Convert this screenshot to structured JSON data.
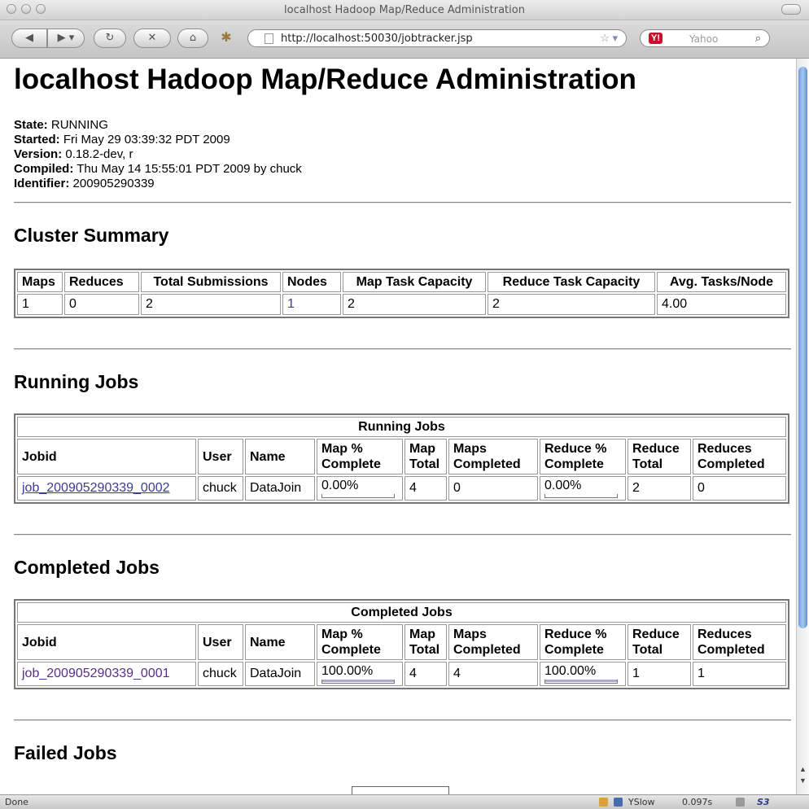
{
  "window": {
    "title": "localhost Hadoop Map/Reduce Administration"
  },
  "toolbar": {
    "url": "http://localhost:50030/jobtracker.jsp",
    "search_placeholder": "Yahoo",
    "yahoo_logo": "Y!"
  },
  "page": {
    "title": "localhost Hadoop Map/Reduce Administration",
    "info": {
      "state_label": "State:",
      "state": "RUNNING",
      "started_label": "Started:",
      "started": "Fri May 29 03:39:32 PDT 2009",
      "version_label": "Version:",
      "version": "0.18.2-dev, r",
      "compiled_label": "Compiled:",
      "compiled": "Thu May 14 15:55:01 PDT 2009 by chuck",
      "identifier_label": "Identifier:",
      "identifier": "200905290339"
    }
  },
  "cluster_summary": {
    "heading": "Cluster Summary",
    "headers": [
      "Maps",
      "Reduces",
      "Total Submissions",
      "Nodes",
      "Map Task Capacity",
      "Reduce Task Capacity",
      "Avg. Tasks/Node"
    ],
    "values": [
      "1",
      "0",
      "2",
      "1",
      "2",
      "2",
      "4.00"
    ]
  },
  "job_headers": [
    "Jobid",
    "User",
    "Name",
    "Map % Complete",
    "Map Total",
    "Maps Completed",
    "Reduce % Complete",
    "Reduce Total",
    "Reduces Completed"
  ],
  "running_jobs": {
    "heading": "Running Jobs",
    "caption": "Running Jobs",
    "rows": [
      {
        "jobid": "job_200905290339_0002",
        "user": "chuck",
        "name": "DataJoin",
        "map_pct": "0.00%",
        "map_pct_value": 0,
        "map_total": "4",
        "maps_completed": "0",
        "reduce_pct": "0.00%",
        "reduce_pct_value": 0,
        "reduce_total": "2",
        "reduces_completed": "0"
      }
    ]
  },
  "completed_jobs": {
    "heading": "Completed Jobs",
    "caption": "Completed Jobs",
    "rows": [
      {
        "jobid": "job_200905290339_0001",
        "user": "chuck",
        "name": "DataJoin",
        "map_pct": "100.00%",
        "map_pct_value": 100,
        "map_total": "4",
        "maps_completed": "4",
        "reduce_pct": "100.00%",
        "reduce_pct_value": 100,
        "reduce_total": "1",
        "reduces_completed": "1"
      }
    ]
  },
  "failed_jobs": {
    "heading": "Failed Jobs"
  },
  "statusbar": {
    "status": "Done",
    "yslow": "YSlow",
    "load_time": "0.097s",
    "s3": "S3"
  },
  "colors": {
    "link": "#3a3a9a",
    "visited_link": "#5a2d8a",
    "progress_fill": "#b0a4d8",
    "scroll_thumb": "#6f9fd9"
  }
}
